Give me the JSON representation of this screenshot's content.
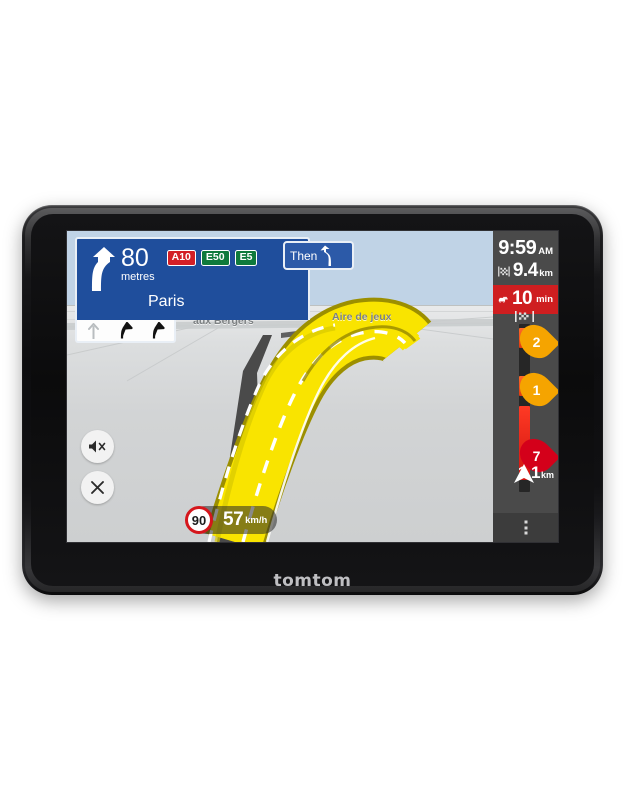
{
  "device": {
    "brand": "tomtom"
  },
  "instruction": {
    "distance_value": "80",
    "distance_unit": "metres",
    "street": "Paris",
    "turn_icon": "bear-right-arrow-icon",
    "shields": [
      {
        "label": "A10",
        "color": "#d31f26",
        "style": "red"
      },
      {
        "label": "E50",
        "color": "#0f7a3c",
        "style": "green"
      },
      {
        "label": "E5",
        "color": "#0f7a3c",
        "style": "green"
      }
    ],
    "lanes": [
      {
        "icon": "lane-straight-icon",
        "active": false
      },
      {
        "icon": "lane-bear-right-icon",
        "active": true
      },
      {
        "icon": "lane-bear-right-icon",
        "active": true
      }
    ]
  },
  "then_panel": {
    "label": "Then",
    "icon": "bear-left-arrow-icon"
  },
  "map": {
    "labels": [
      {
        "text": "aux Bergers"
      },
      {
        "text": "Aire de jeux"
      }
    ],
    "sky_color": "#c0d3e6",
    "ground_color": "#d2d4d5",
    "route_color": "#f7e300",
    "road_color": "#4a4a4a"
  },
  "route_bar": {
    "arrival_time": "9:59",
    "arrival_meridiem": "AM",
    "remaining_distance": "9.4",
    "remaining_distance_unit": "km",
    "delay_value": "10",
    "delay_unit": "min",
    "delay_color": "#cf1e20",
    "destination_icon": "checkered-flag-icon",
    "delay_icon": "traffic-car-icon",
    "incidents": [
      {
        "value": "2",
        "severity": "amber"
      },
      {
        "value": "1",
        "severity": "amber"
      },
      {
        "value": "7",
        "severity": "red"
      }
    ],
    "position_distance": "1.1",
    "position_distance_unit": "km",
    "position_icon": "position-arrow-icon",
    "menu_icon": "kebab-menu-icon"
  },
  "controls": {
    "mute_icon": "mute-speaker-icon",
    "close_icon": "close-x-icon"
  },
  "speed": {
    "limit": "90",
    "current": "57",
    "unit": "km/h",
    "limit_ring_color": "#d5161c"
  }
}
